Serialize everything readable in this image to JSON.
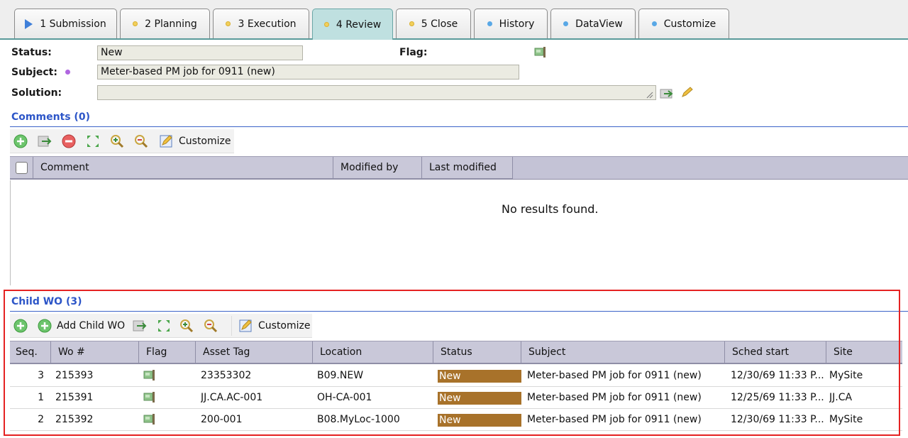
{
  "tabs": [
    {
      "label": "1 Submission",
      "marker": "play-triangle-icon"
    },
    {
      "label": "2 Planning",
      "marker": "yellow-dot"
    },
    {
      "label": "3 Execution",
      "marker": "yellow-dot"
    },
    {
      "label": "4 Review",
      "marker": "yellow-dot",
      "active": true
    },
    {
      "label": "5 Close",
      "marker": "yellow-dot"
    },
    {
      "label": "History",
      "marker": "blue-dot"
    },
    {
      "label": "DataView",
      "marker": "blue-dot"
    },
    {
      "label": "Customize",
      "marker": "blue-dot"
    }
  ],
  "form": {
    "status_label": "Status:",
    "status_value": "New",
    "flag_label": "Flag:",
    "subject_label": "Subject:",
    "subject_value": "Meter-based PM job for 0911 (new)",
    "solution_label": "Solution:",
    "solution_value": ""
  },
  "comments": {
    "title": "Comments (0)",
    "customize_label": "Customize",
    "columns": [
      "Comment",
      "Modified by",
      "Last modified"
    ],
    "empty_message": "No results found."
  },
  "child_wo": {
    "title": "Child WO (3)",
    "add_label": "Add Child WO",
    "customize_label": "Customize",
    "columns": [
      "Seq.",
      "Wo #",
      "Flag",
      "Asset Tag",
      "Location",
      "Status",
      "Subject",
      "Sched start",
      "Site"
    ],
    "rows": [
      {
        "seq": "3",
        "wo": "215393",
        "asset": "23353302",
        "location": "B09.NEW",
        "status": "New",
        "subject": "Meter-based PM job for 0911 (new)",
        "sched": "12/30/69 11:33 P...",
        "site": "MySite"
      },
      {
        "seq": "1",
        "wo": "215391",
        "asset": "JJ.CA.AC-001",
        "location": "OH-CA-001",
        "status": "New",
        "subject": "Meter-based PM job for 0911 (new)",
        "sched": "12/25/69 11:33 P...",
        "site": "JJ.CA"
      },
      {
        "seq": "2",
        "wo": "215392",
        "asset": "200-001",
        "location": "B08.MyLoc-1000",
        "status": "New",
        "subject": "Meter-based PM job for 0911 (new)",
        "sched": "12/30/69 11:33 P...",
        "site": "MySite"
      }
    ]
  },
  "colors": {
    "section_title": "#2d56c8",
    "active_tab": "#bfe0e0",
    "status_new": "#a8722a",
    "highlight_box": "#e52222",
    "grid_header": "#c9c8d9"
  }
}
